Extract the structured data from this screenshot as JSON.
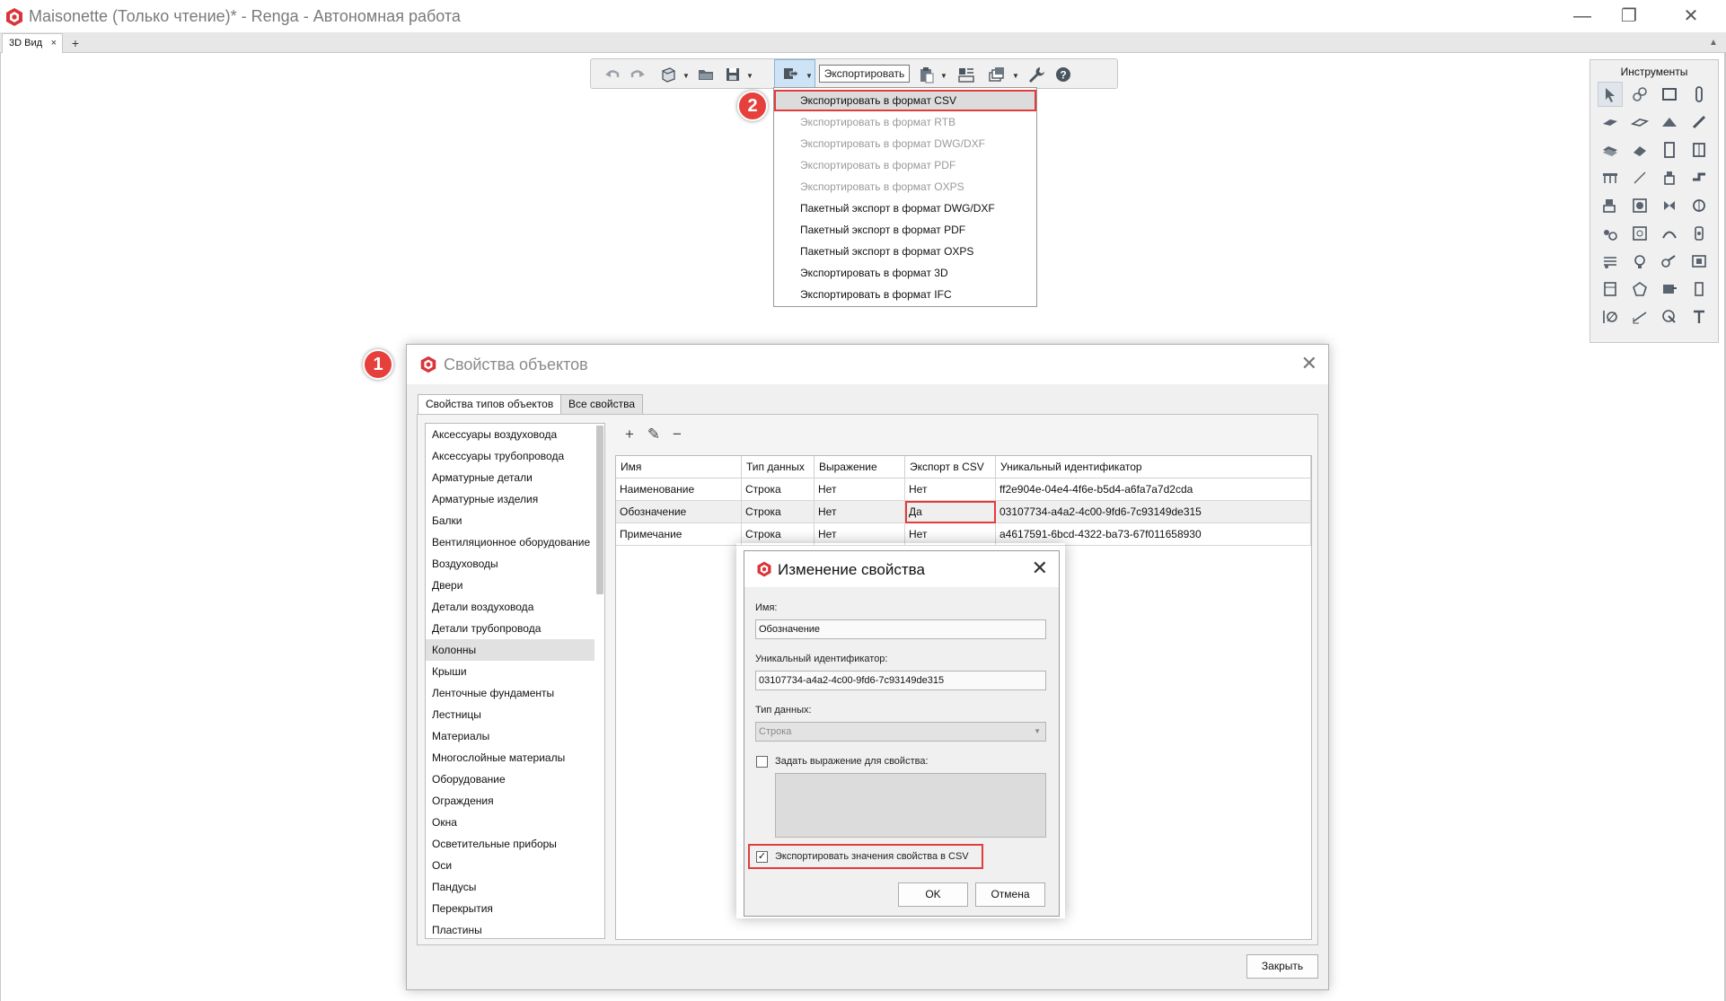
{
  "window": {
    "title": "Maisonette (Только чтение)* - Renga - Автономная работа",
    "minimize": "—",
    "maximize": "❐",
    "close": "✕",
    "brand_color": "#d9343a"
  },
  "tabs": {
    "active": "3D Вид",
    "close_glyph": "×",
    "add_glyph": "+",
    "menu_glyph": "▲"
  },
  "toolbar": {
    "tooltip": "Экспортировать",
    "icons": [
      "undo-icon",
      "redo-icon",
      "view-cube-icon",
      "open-folder-icon",
      "save-icon",
      "export-icon",
      "print-icon",
      "cut-icon",
      "copy-icon",
      "paste-icon",
      "object-properties-icon",
      "layers-icon",
      "settings-wrench-icon",
      "help-icon"
    ]
  },
  "export_menu": {
    "items": [
      {
        "label": "Экспортировать в формат CSV",
        "enabled": true,
        "highlighted": true
      },
      {
        "label": "Экспортировать в формат RTB",
        "enabled": false
      },
      {
        "label": "Экспортировать в формат DWG/DXF",
        "enabled": false
      },
      {
        "label": "Экспортировать в формат PDF",
        "enabled": false
      },
      {
        "label": "Экспортировать в формат OXPS",
        "enabled": false
      },
      {
        "label": "Пакетный экспорт в формат DWG/DXF",
        "enabled": true
      },
      {
        "label": "Пакетный экспорт в формат PDF",
        "enabled": true
      },
      {
        "label": "Пакетный экспорт в формат OXPS",
        "enabled": true
      },
      {
        "label": "Экспортировать в формат 3D",
        "enabled": true
      },
      {
        "label": "Экспортировать в формат IFC",
        "enabled": true
      }
    ]
  },
  "badges": {
    "one": "1",
    "two": "2",
    "color": "#e6403c"
  },
  "instruments": {
    "title": "Инструменты",
    "tools": [
      "select-icon",
      "level-icon",
      "wall-icon",
      "column-icon",
      "slab-icon",
      "floor-icon",
      "roof-icon",
      "beam-icon",
      "ramp-icon",
      "stair-icon",
      "door-icon",
      "window-icon",
      "railing-icon",
      "line-icon",
      "plumbing-icon",
      "duct-icon",
      "equipment-icon",
      "boiler-icon",
      "fan-icon",
      "pipe-fitting-icon",
      "valve-icon",
      "accessory-icon",
      "duct-fitting-icon",
      "pipe-accessory-icon",
      "heater-icon",
      "lamp-icon",
      "wiring-icon",
      "light-switch-icon",
      "panel-icon",
      "element-icon",
      "route-icon",
      "box-icon",
      "axis-icon",
      "dimension-icon",
      "hatch-icon",
      "text-icon"
    ]
  },
  "properties_dialog": {
    "title": "Свойства объектов",
    "tabs": [
      "Свойства типов объектов",
      "Все свойства"
    ],
    "categories": [
      "Аксессуары воздуховода",
      "Аксессуары трубопровода",
      "Арматурные детали",
      "Арматурные изделия",
      "Балки",
      "Вентиляционное оборудование",
      "Воздуховоды",
      "Двери",
      "Детали воздуховода",
      "Детали трубопровода",
      "Колонны",
      "Крыши",
      "Ленточные фундаменты",
      "Лестницы",
      "Материалы",
      "Многослойные материалы",
      "Оборудование",
      "Ограждения",
      "Окна",
      "Осветительные приборы",
      "Оси",
      "Пандусы",
      "Перекрытия",
      "Пластины"
    ],
    "selected_category": "Колонны",
    "grid_toolbar": {
      "add": "+",
      "edit": "✎",
      "delete": "−"
    },
    "columns": [
      "Имя",
      "Тип данных",
      "Выражение",
      "Экспорт в CSV",
      "Уникальный идентификатор"
    ],
    "rows": [
      [
        "Наименование",
        "Строка",
        "Нет",
        "Нет",
        "ff2e904e-04e4-4f6e-b5d4-a6fa7a7d2cda"
      ],
      [
        "Обозначение",
        "Строка",
        "Нет",
        "Да",
        "03107734-a4a2-4c00-9fd6-7c93149de315"
      ],
      [
        "Примечание",
        "Строка",
        "Нет",
        "Нет",
        "a4617591-6bcd-4322-ba73-67f011658930"
      ]
    ],
    "close_button": "Закрыть"
  },
  "edit_dialog": {
    "title": "Изменение свойства",
    "name_label": "Имя:",
    "name_value": "Обозначение",
    "uid_label": "Уникальный идентификатор:",
    "uid_value": "03107734-a4a2-4c00-9fd6-7c93149de315",
    "type_label": "Тип данных:",
    "type_value": "Строка",
    "expr_checkbox": "Задать выражение для свойства:",
    "expr_checked": false,
    "csv_checkbox": "Экспортировать значения свойства в CSV",
    "csv_checked": true,
    "ok": "OK",
    "cancel": "Отмена"
  }
}
